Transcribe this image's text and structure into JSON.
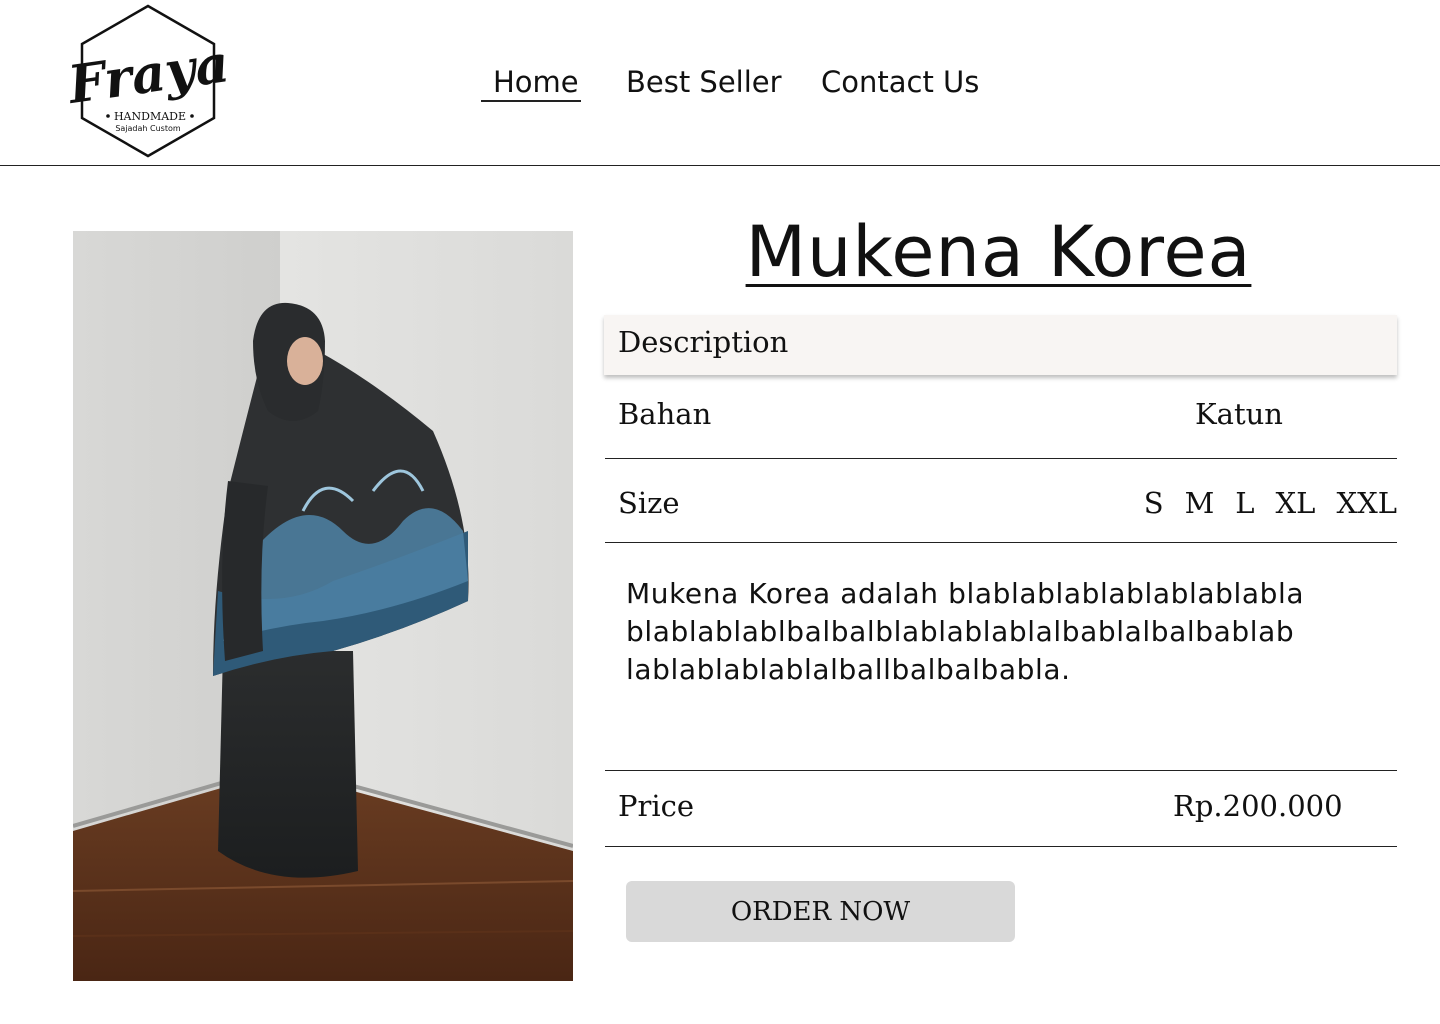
{
  "header": {
    "logo": {
      "icon": "fraya-logo",
      "script_text": "Fraya",
      "tagline": "HANDMADE",
      "subtitle": "Sajadah Custom"
    },
    "nav": [
      {
        "label": "Home",
        "active": true
      },
      {
        "label": "Best Seller",
        "active": false
      },
      {
        "label": "Contact Us",
        "active": false
      }
    ]
  },
  "product": {
    "image": {
      "icon": "product-photo",
      "alt": "Mukena Korea"
    },
    "title": "Mukena Korea",
    "description_header": "Description",
    "bahan": {
      "label": "Bahan",
      "value": "Katun"
    },
    "size": {
      "label": "Size",
      "options": [
        "S",
        "M",
        "L",
        "XL",
        "XXL"
      ]
    },
    "description_lines": [
      "Mukena Korea adalah blablablablablablablabla",
      "blablablablbalbalblablablablalbablalbalbablab",
      "lablablablablalballbalbalbabla."
    ],
    "price": {
      "label": "Price",
      "value": "Rp.200.000"
    },
    "order_button": "ORDER NOW"
  },
  "colors": {
    "background": "#ffffff",
    "desc_bar": "#f8f5f3",
    "button": "#d9d9d9",
    "text": "#111111"
  }
}
